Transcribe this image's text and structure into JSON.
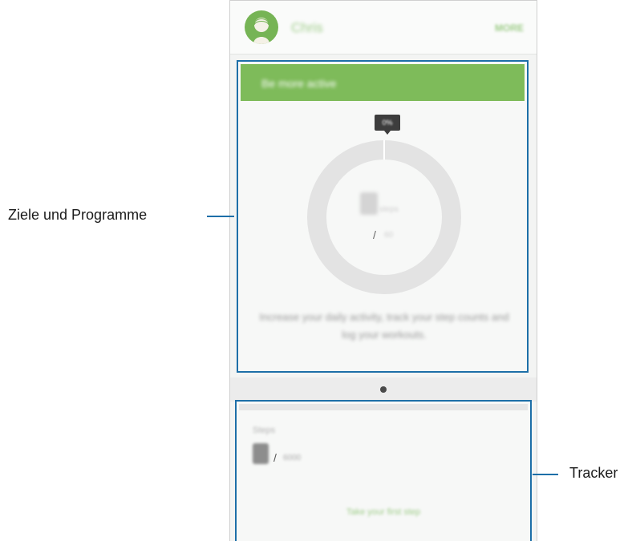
{
  "profile": {
    "username": "Chris",
    "more_label": "MORE"
  },
  "goals_card": {
    "title": "Be more active",
    "percent": "0%",
    "progress_fraction": 0,
    "current_steps": "0",
    "steps_unit": "steps",
    "slash": "/",
    "target": "60",
    "description": "Increase your daily activity, track your step counts and log your workouts."
  },
  "pager": {
    "active_index": 0,
    "count": 1
  },
  "tracker_card": {
    "label": "Steps",
    "current": "0",
    "slash": "/",
    "target": "6000",
    "link": "Take your first step"
  },
  "callouts": {
    "goals": "Ziele und Programme",
    "tracker": "Tracker"
  },
  "colors": {
    "accent_green": "#7ebb5a",
    "highlight_blue": "#1d6fa8",
    "ring_gray": "#e3e3e3"
  },
  "icons": {
    "avatar": "user-avatar-icon"
  }
}
